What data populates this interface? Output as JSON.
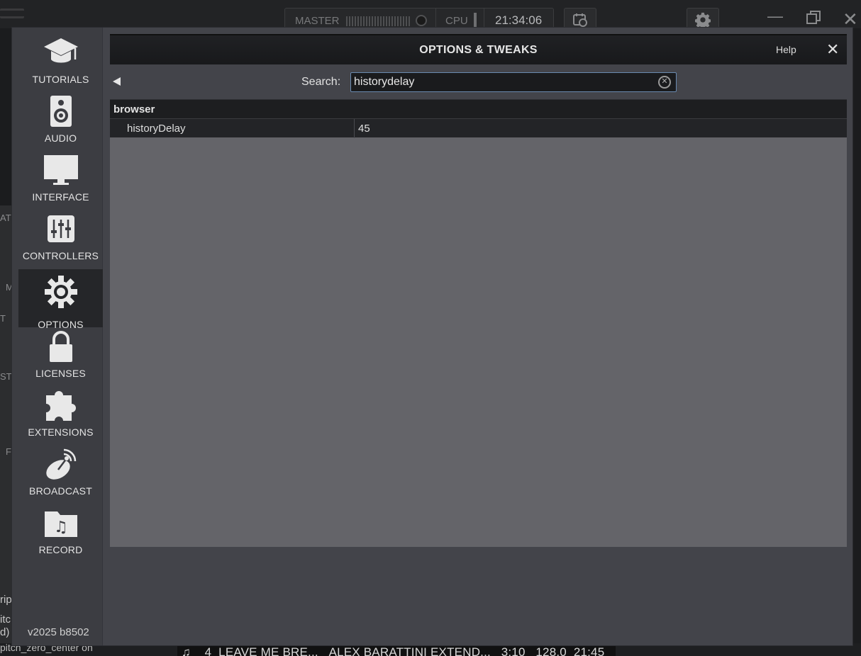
{
  "background_app": {
    "master_label": "MASTER",
    "cpu_label": "CPU",
    "clock": "21:34:06",
    "left_fragments": [
      "AT",
      "M",
      "T",
      "ST",
      "F",
      "rip",
      "itc",
      "d)"
    ],
    "bottom_left_text": "pitch_zero_center  on",
    "track_strip": {
      "number": "4",
      "title": "LEAVE ME BRE...",
      "artist": "ALEX BARATTINI EXTEND...",
      "length": "3:10",
      "bpm": "128.0",
      "time": "21:45"
    }
  },
  "dialog": {
    "title": "OPTIONS & TWEAKS",
    "help_label": "Help",
    "close_label": "✕",
    "version": "v2025 b8502",
    "search": {
      "label": "Search:",
      "value": "historydelay"
    },
    "sidebar": [
      {
        "label": "TUTORIALS",
        "icon": "graduation-cap-icon"
      },
      {
        "label": "AUDIO",
        "icon": "speaker-icon"
      },
      {
        "label": "INTERFACE",
        "icon": "monitor-icon"
      },
      {
        "label": "CONTROLLERS",
        "icon": "sliders-icon"
      },
      {
        "label": "OPTIONS",
        "icon": "gear-icon",
        "active": true
      },
      {
        "label": "LICENSES",
        "icon": "lock-icon"
      },
      {
        "label": "EXTENSIONS",
        "icon": "puzzle-icon"
      },
      {
        "label": "BROADCAST",
        "icon": "satellite-dish-icon"
      },
      {
        "label": "RECORD",
        "icon": "music-folder-icon"
      }
    ],
    "results": {
      "group": "browser",
      "rows": [
        {
          "key": "historyDelay",
          "value": "45"
        }
      ]
    }
  }
}
